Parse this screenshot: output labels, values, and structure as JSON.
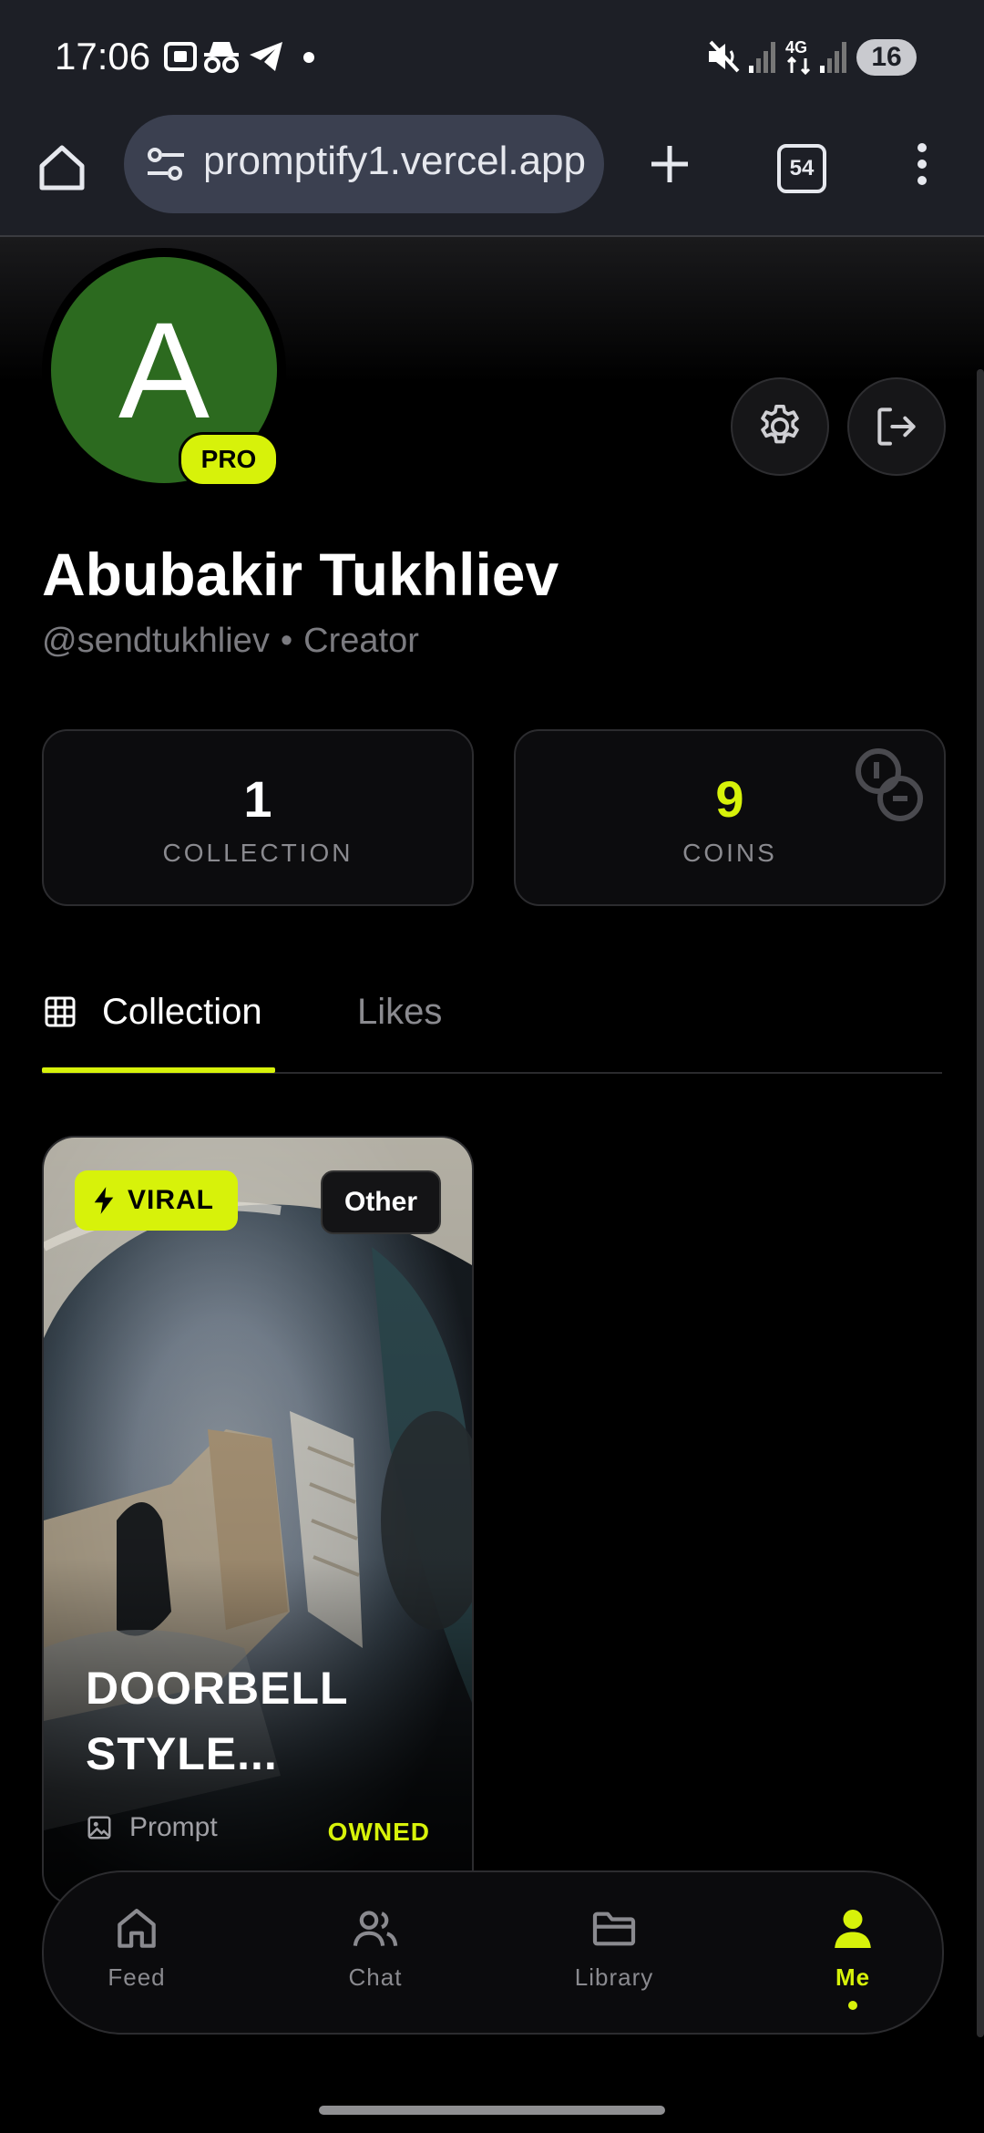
{
  "status_bar": {
    "time": "17:06",
    "battery": "16",
    "icons": [
      "screenshot-icon",
      "incognito-icon",
      "telegram-icon",
      "notification-dot",
      "mute-icon",
      "signal-icon",
      "4g-icon",
      "signal-icon"
    ]
  },
  "browser": {
    "url": "promptify1.vercel.app",
    "tab_count": "54"
  },
  "profile": {
    "avatar_initial": "A",
    "badge": "PRO",
    "name": "Abubakir Tukhliev",
    "handle": "@sendtukhliev",
    "separator": "•",
    "role": "Creator"
  },
  "stats": [
    {
      "value": "1",
      "label": "COLLECTION"
    },
    {
      "value": "9",
      "label": "COINS"
    }
  ],
  "tabs": [
    {
      "label": "Collection",
      "active": true
    },
    {
      "label": "Likes",
      "active": false
    }
  ],
  "cards": [
    {
      "badge": "VIRAL",
      "category": "Other",
      "title": "DOORBELL STYLE...",
      "type": "Prompt",
      "status": "OWNED"
    }
  ],
  "nav": [
    {
      "label": "Feed",
      "icon": "home-icon"
    },
    {
      "label": "Chat",
      "icon": "users-icon"
    },
    {
      "label": "Library",
      "icon": "folder-icon"
    },
    {
      "label": "Me",
      "icon": "user-icon",
      "active": true
    }
  ],
  "colors": {
    "accent": "#d7f20a",
    "background": "#000000",
    "avatar_bg": "#2c6a1f",
    "browser_chrome": "#1d1f26"
  }
}
